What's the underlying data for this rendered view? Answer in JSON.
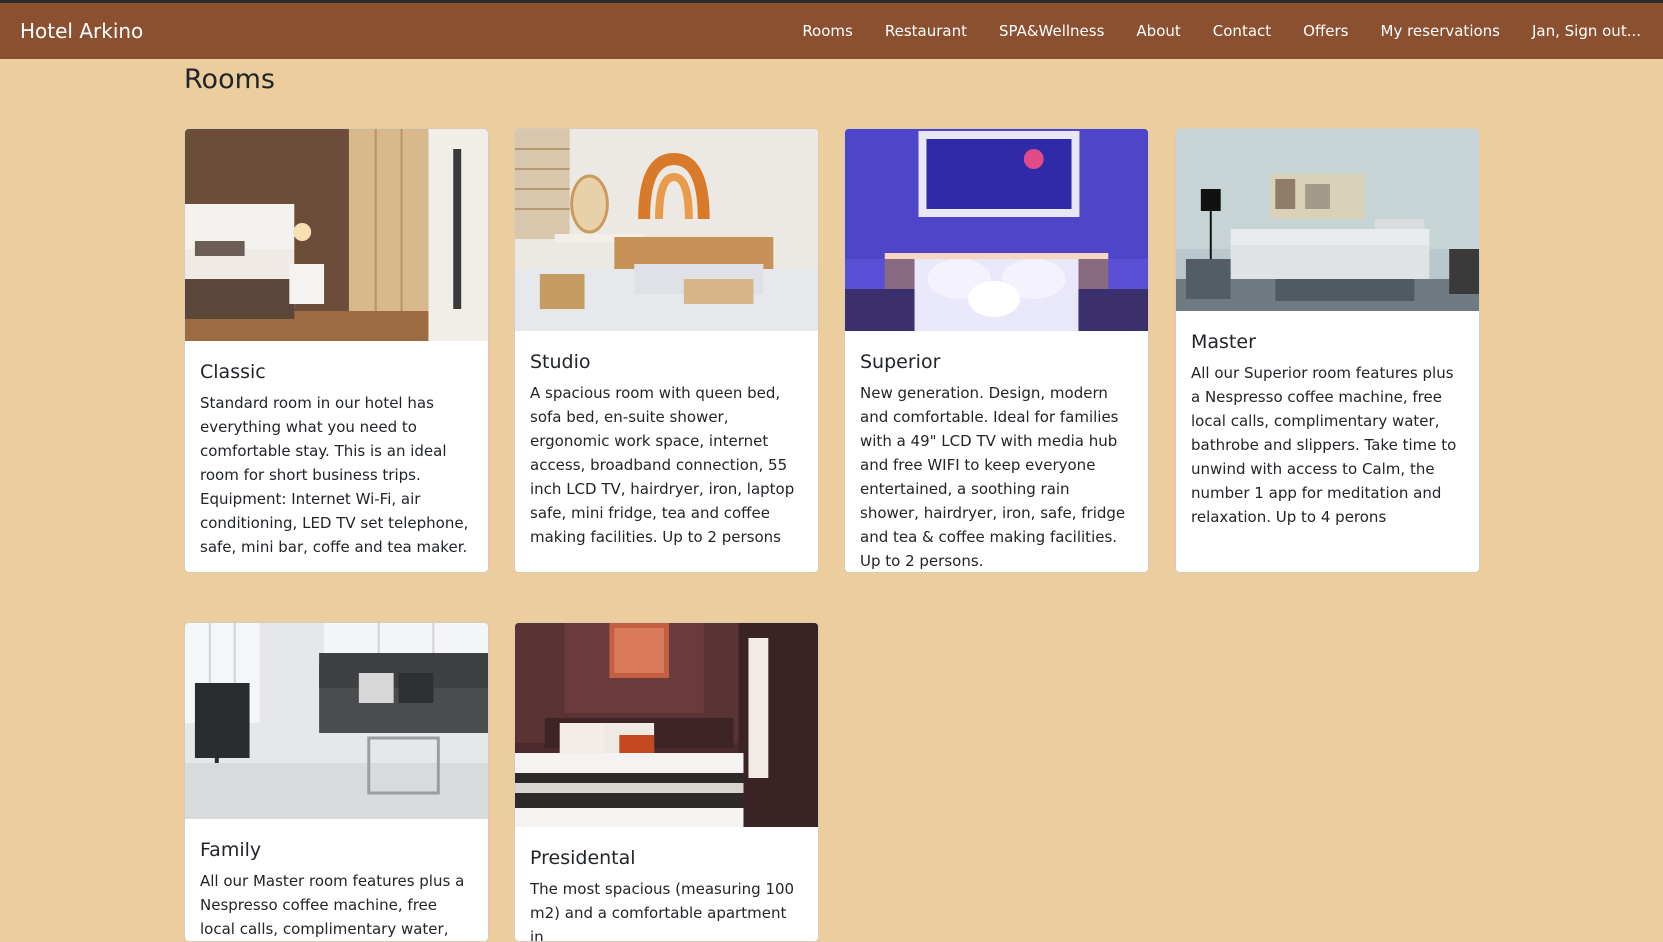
{
  "navbar": {
    "brand": "Hotel Arkino",
    "links": [
      "Rooms",
      "Restaurant",
      "SPA&Wellness",
      "About",
      "Contact",
      "Offers",
      "My reservations",
      "Jan, Sign out..."
    ]
  },
  "page": {
    "title": "Rooms"
  },
  "rooms": [
    {
      "title": "Classic",
      "image": "bedroom-photo",
      "description": "Standard room in our hotel has everything what you need to comfortable stay. This is an ideal room for short business trips. Equipment: Internet Wi-Fi, air conditioning, LED TV set telephone, safe, mini bar, coffe and tea maker."
    },
    {
      "title": "Studio",
      "image": "studio-bedroom-photo",
      "description": "A spacious room with queen bed, sofa bed, en-suite shower, ergonomic work space, internet access, broadband connection, 55 inch LCD TV, hairdryer, iron, laptop safe, mini fridge, tea and coffee making facilities. Up to 2 persons"
    },
    {
      "title": "Superior",
      "image": "purple-lit-bedroom-photo",
      "description": "New generation. Design, modern and comfortable. Ideal for families with a 49\" LCD TV with media hub and free WIFI to keep everyone entertained, a soothing rain shower, hairdryer, iron, safe, fridge and tea & coffee making facilities. Up to 2 persons."
    },
    {
      "title": "Master",
      "image": "living-room-photo",
      "description": "All our Superior room features plus a Nespresso coffee machine, free local calls, complimentary water, bathrobe and slippers. Take time to unwind with access to Calm, the number 1 app for meditation and relaxation. Up to 4 perons"
    },
    {
      "title": "Family",
      "image": "lounge-photo",
      "description": "All our Master room features plus a Nespresso coffee machine, free local calls, complimentary water, bathrobe"
    },
    {
      "title": "Presidental",
      "image": "presidential-bedroom-photo",
      "description": "The most spacious (measuring 100 m2) and a comfortable apartment in"
    }
  ]
}
